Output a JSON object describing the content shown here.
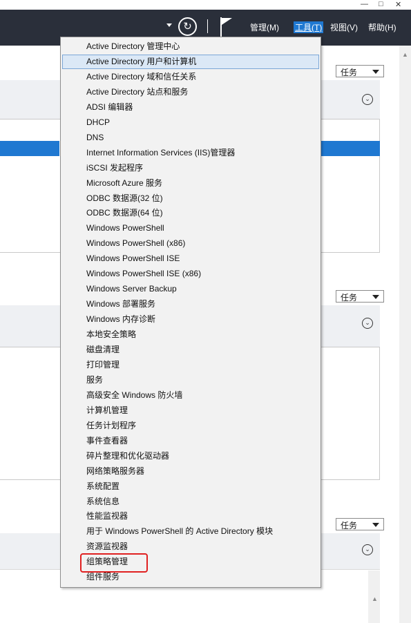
{
  "titlebar": {
    "minimize": "—",
    "maximize": "□",
    "close": "✕"
  },
  "header": {
    "menus": [
      {
        "label": "管理(M)"
      },
      {
        "label": "工具(T)"
      },
      {
        "label": "视图(V)"
      },
      {
        "label": "帮助(H)"
      }
    ],
    "active_menu": "工具(T)",
    "refresh_glyph": "↻"
  },
  "panels": {
    "task_label": "任务"
  },
  "tools_menu": {
    "items": [
      "Active Directory 管理中心",
      "Active Directory 用户和计算机",
      "Active Directory 域和信任关系",
      "Active Directory 站点和服务",
      "ADSI 编辑器",
      "DHCP",
      "DNS",
      "Internet Information Services (IIS)管理器",
      "iSCSI 发起程序",
      "Microsoft Azure 服务",
      "ODBC 数据源(32 位)",
      "ODBC 数据源(64 位)",
      "Windows PowerShell",
      "Windows PowerShell (x86)",
      "Windows PowerShell ISE",
      "Windows PowerShell ISE (x86)",
      "Windows Server Backup",
      "Windows 部署服务",
      "Windows 内存诊断",
      "本地安全策略",
      "磁盘清理",
      "打印管理",
      "服务",
      "高级安全 Windows 防火墙",
      "计算机管理",
      "任务计划程序",
      "事件查看器",
      "碎片整理和优化驱动器",
      "网络策略服务器",
      "系统配置",
      "系统信息",
      "性能监视器",
      "用于 Windows PowerShell 的 Active Directory 模块",
      "资源监视器",
      "组策略管理",
      "组件服务"
    ],
    "highlighted": "Active Directory 用户和计算机",
    "annotated": "组策略管理"
  },
  "colors": {
    "header_bg": "#2a2f3a",
    "accent": "#1f78d1",
    "annotation": "#e02020"
  }
}
